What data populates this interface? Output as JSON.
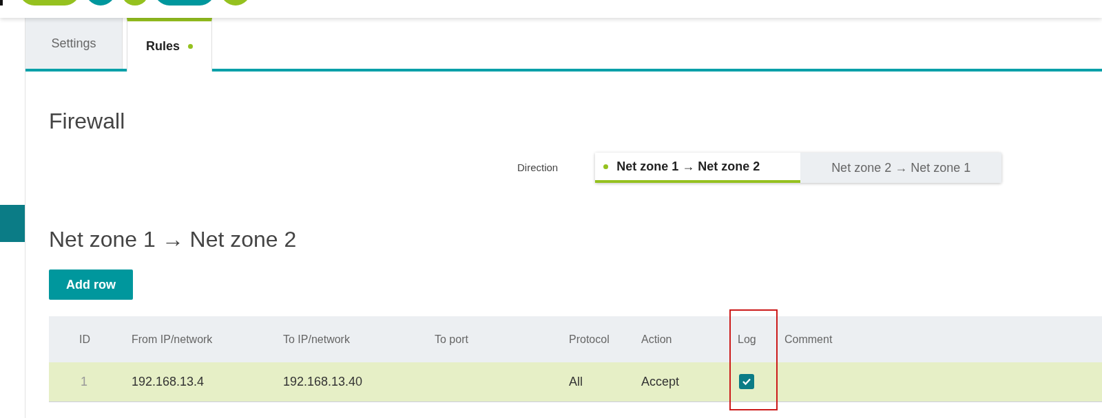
{
  "tabs": [
    {
      "label": "Settings",
      "selected": false,
      "dot": false
    },
    {
      "label": "Rules",
      "selected": true,
      "dot": true
    }
  ],
  "title": "Firewall",
  "direction": {
    "label": "Direction",
    "options": [
      {
        "label": "Net zone 1 → Net zone 2",
        "selected": true
      },
      {
        "label": "Net zone 2 → Net zone 1",
        "selected": false
      }
    ]
  },
  "section": {
    "title": "Net zone 1 → Net zone 2",
    "add_button": "Add row"
  },
  "table": {
    "columns": [
      {
        "label": "ID",
        "highlighted": false
      },
      {
        "label": "From IP/network",
        "highlighted": false
      },
      {
        "label": "To IP/network",
        "highlighted": false
      },
      {
        "label": "To port",
        "highlighted": false
      },
      {
        "label": "Protocol",
        "highlighted": false
      },
      {
        "label": "Action",
        "highlighted": false
      },
      {
        "label": "Log",
        "highlighted": true
      },
      {
        "label": "Comment",
        "highlighted": false
      }
    ],
    "rows": [
      {
        "id": "1",
        "from": "192.168.13.4",
        "to": "192.168.13.40",
        "protocol": "All",
        "action": "Accept",
        "log": true
      }
    ]
  }
}
